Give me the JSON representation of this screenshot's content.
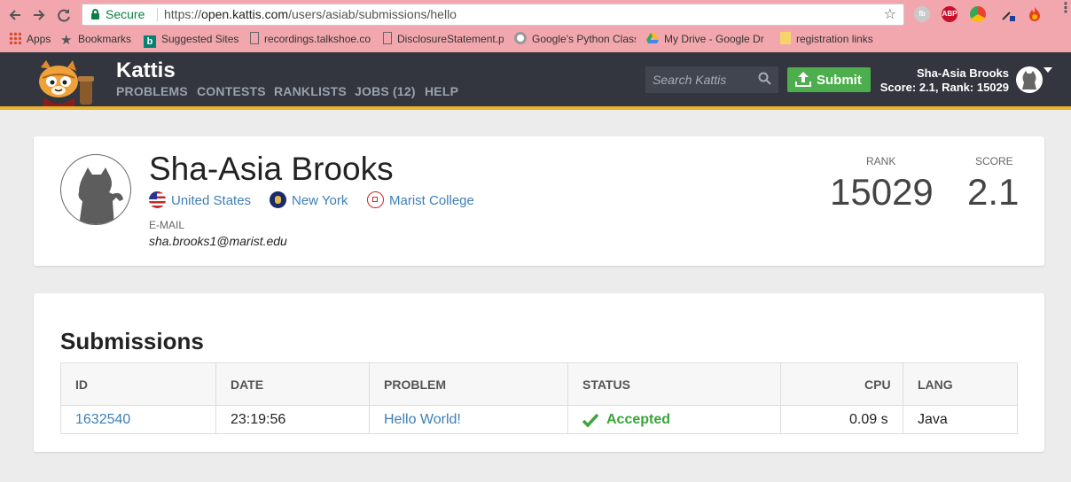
{
  "browser": {
    "secure_label": "Secure",
    "url_scheme": "https://",
    "url_host": "open.kattis.com",
    "url_path": "/users/asiab/submissions/hello",
    "ext_fb": "fb",
    "ext_abp": "ABP"
  },
  "bookmarks": [
    {
      "label": "Apps"
    },
    {
      "label": "Bookmarks"
    },
    {
      "label": "Suggested Sites"
    },
    {
      "label": "recordings.talkshoe.co"
    },
    {
      "label": "DisclosureStatement.p"
    },
    {
      "label": "Google's Python Class"
    },
    {
      "label": "My Drive - Google Dr"
    },
    {
      "label": "registration links"
    }
  ],
  "header": {
    "brand": "Kattis",
    "nav": [
      "PROBLEMS",
      "CONTESTS",
      "RANKLISTS",
      "JOBS (12)",
      "HELP"
    ],
    "search_placeholder": "Search Kattis",
    "submit_label": "Submit",
    "user_name": "Sha-Asia Brooks",
    "user_score": "Score: 2.1, Rank: 15029"
  },
  "profile": {
    "name": "Sha-Asia Brooks",
    "country": "United States",
    "state": "New York",
    "school": "Marist College",
    "email_label": "E-MAIL",
    "email": "sha.brooks1@marist.edu",
    "rank_label": "RANK",
    "rank": "15029",
    "score_label": "SCORE",
    "score": "2.1"
  },
  "submissions": {
    "title": "Submissions",
    "columns": [
      "ID",
      "DATE",
      "PROBLEM",
      "STATUS",
      "CPU",
      "LANG"
    ],
    "rows": [
      {
        "id": "1632540",
        "date": "23:19:56",
        "problem": "Hello World!",
        "status": "Accepted",
        "cpu": "0.09 s",
        "lang": "Java"
      }
    ]
  },
  "colors": {
    "chrome_bg": "#f2a7ae",
    "header_bg": "#33363f",
    "accent_border": "#e6b32a",
    "submit_green": "#4cae4c",
    "link_blue": "#3d7fb5",
    "accepted_green": "#3aa53a"
  }
}
